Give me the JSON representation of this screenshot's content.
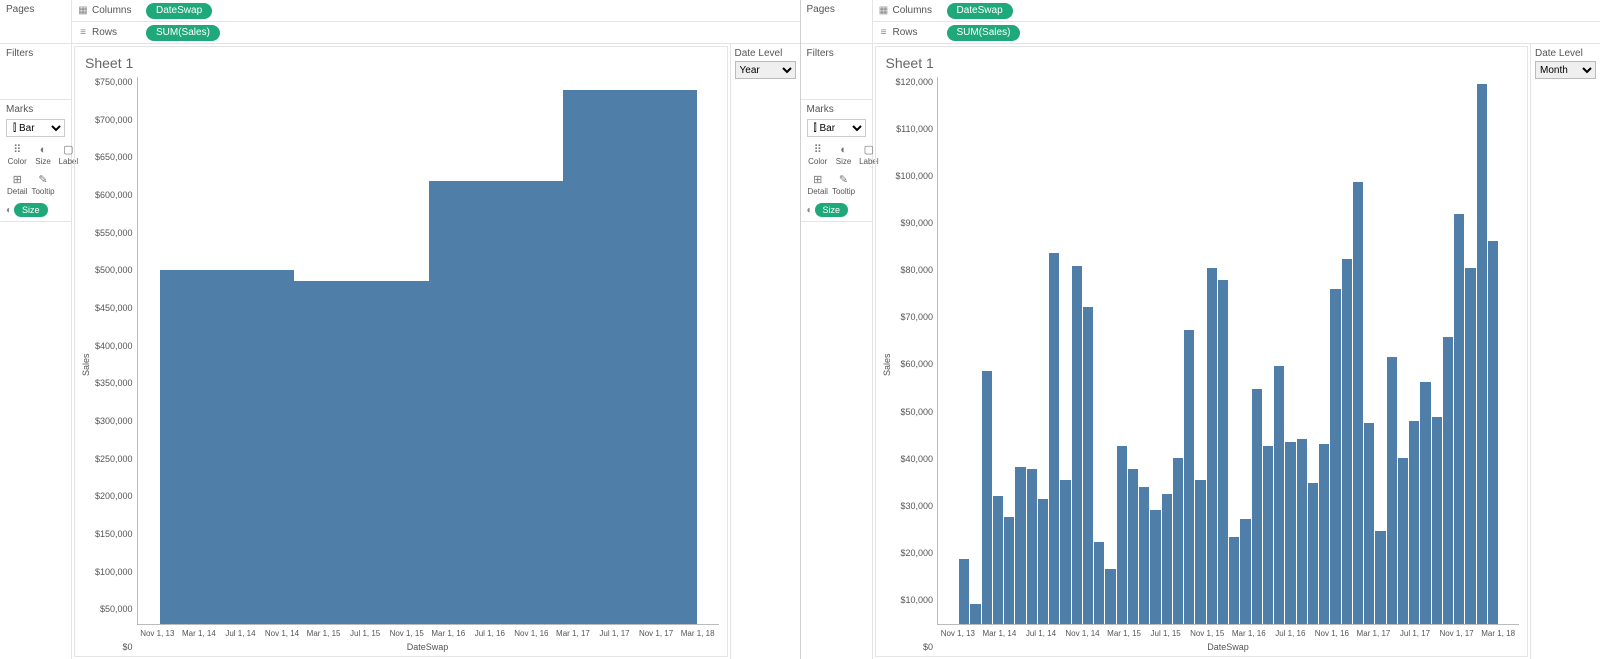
{
  "left": {
    "shelves": {
      "pages_label": "Pages",
      "columns_label": "Columns",
      "rows_label": "Rows",
      "columns_pill": "DateSwap",
      "rows_pill": "SUM(Sales)"
    },
    "filters_label": "Filters",
    "marks": {
      "label": "Marks",
      "type": "Bar",
      "type_display": "⫿ Bar",
      "buttons": {
        "color": "Color",
        "size": "Size",
        "label": "Label",
        "detail": "Detail",
        "tooltip": "Tooltip"
      },
      "size_pill": "Size"
    },
    "param": {
      "label": "Date Level",
      "value": "Year"
    },
    "viz_title": "Sheet 1",
    "x_label": "DateSwap",
    "y_label": "Sales"
  },
  "right": {
    "shelves": {
      "pages_label": "Pages",
      "columns_label": "Columns",
      "rows_label": "Rows",
      "columns_pill": "DateSwap",
      "rows_pill": "SUM(Sales)"
    },
    "filters_label": "Filters",
    "marks": {
      "label": "Marks",
      "type": "Bar",
      "type_display": "⫿ Bar",
      "buttons": {
        "color": "Color",
        "size": "Size",
        "label": "Label",
        "detail": "Detail",
        "tooltip": "Tooltip"
      },
      "size_pill": "Size"
    },
    "param": {
      "label": "Date Level",
      "value": "Month"
    },
    "viz_title": "Sheet 1",
    "x_label": "DateSwap",
    "y_label": "Sales"
  },
  "chart_data": [
    {
      "id": "left",
      "type": "bar",
      "title": "Sheet 1",
      "xlabel": "DateSwap",
      "ylabel": "Sales",
      "ylim": [
        0,
        750000
      ],
      "y_ticks": [
        "$750,000",
        "$700,000",
        "$650,000",
        "$600,000",
        "$550,000",
        "$500,000",
        "$450,000",
        "$400,000",
        "$350,000",
        "$300,000",
        "$250,000",
        "$200,000",
        "$150,000",
        "$100,000",
        "$50,000",
        "$0"
      ],
      "x_ticks": [
        "Nov 1, 13",
        "Mar 1, 14",
        "Jul 1, 14",
        "Nov 1, 14",
        "Mar 1, 15",
        "Jul 1, 15",
        "Nov 1, 15",
        "Mar 1, 16",
        "Jul 1, 16",
        "Nov 1, 16",
        "Mar 1, 17",
        "Jul 1, 17",
        "Nov 1, 17",
        "Mar 1, 18"
      ],
      "bars": [
        {
          "start": "Jan 1, 14",
          "end": "Jan 1, 15",
          "value": 485000
        },
        {
          "start": "Jan 1, 15",
          "end": "Jan 1, 16",
          "value": 470000
        },
        {
          "start": "Jan 1, 16",
          "end": "Jan 1, 17",
          "value": 608000
        },
        {
          "start": "Jan 1, 17",
          "end": "Jan 1, 18",
          "value": 732000
        }
      ],
      "axis_start": "Nov 1, 13",
      "axis_end": "Mar 1, 18",
      "axis_months": 52
    },
    {
      "id": "right",
      "type": "bar",
      "title": "Sheet 1",
      "xlabel": "DateSwap",
      "ylabel": "Sales",
      "ylim": [
        0,
        120000
      ],
      "y_ticks": [
        "$120,000",
        "$110,000",
        "$100,000",
        "$90,000",
        "$80,000",
        "$70,000",
        "$60,000",
        "$50,000",
        "$40,000",
        "$30,000",
        "$20,000",
        "$10,000",
        "$0"
      ],
      "x_ticks": [
        "Nov 1, 13",
        "Mar 1, 14",
        "Jul 1, 14",
        "Nov 1, 14",
        "Mar 1, 15",
        "Jul 1, 15",
        "Nov 1, 15",
        "Mar 1, 16",
        "Jul 1, 16",
        "Nov 1, 16",
        "Mar 1, 17",
        "Jul 1, 17",
        "Nov 1, 17",
        "Mar 1, 18"
      ],
      "categories": [
        "Jan 14",
        "Feb 14",
        "Mar 14",
        "Apr 14",
        "May 14",
        "Jun 14",
        "Jul 14",
        "Aug 14",
        "Sep 14",
        "Oct 14",
        "Nov 14",
        "Dec 14",
        "Jan 15",
        "Feb 15",
        "Mar 15",
        "Apr 15",
        "May 15",
        "Jun 15",
        "Jul 15",
        "Aug 15",
        "Sep 15",
        "Oct 15",
        "Nov 15",
        "Dec 15",
        "Jan 16",
        "Feb 16",
        "Mar 16",
        "Apr 16",
        "May 16",
        "Jun 16",
        "Jul 16",
        "Aug 16",
        "Sep 16",
        "Oct 16",
        "Nov 16",
        "Dec 16",
        "Jan 17",
        "Feb 17",
        "Mar 17",
        "Apr 17",
        "May 17",
        "Jun 17",
        "Jul 17",
        "Aug 17",
        "Sep 17",
        "Oct 17",
        "Nov 17",
        "Dec 17"
      ],
      "values": [
        14200,
        4500,
        55500,
        28000,
        23500,
        34500,
        34000,
        27500,
        81500,
        31500,
        78500,
        69500,
        18000,
        12000,
        39000,
        34000,
        30000,
        25000,
        28500,
        36500,
        64500,
        31500,
        78000,
        75500,
        19000,
        23000,
        51500,
        39000,
        56500,
        40000,
        40500,
        31000,
        39500,
        73500,
        80000,
        97000,
        44000,
        20500,
        58500,
        36500,
        44500,
        53000,
        45500,
        63000,
        90000,
        78000,
        118500,
        84000
      ],
      "axis_start": "Nov 1, 13",
      "axis_end": "Mar 1, 18",
      "axis_months": 52,
      "lead_months": 2,
      "trail_months": 2
    }
  ]
}
